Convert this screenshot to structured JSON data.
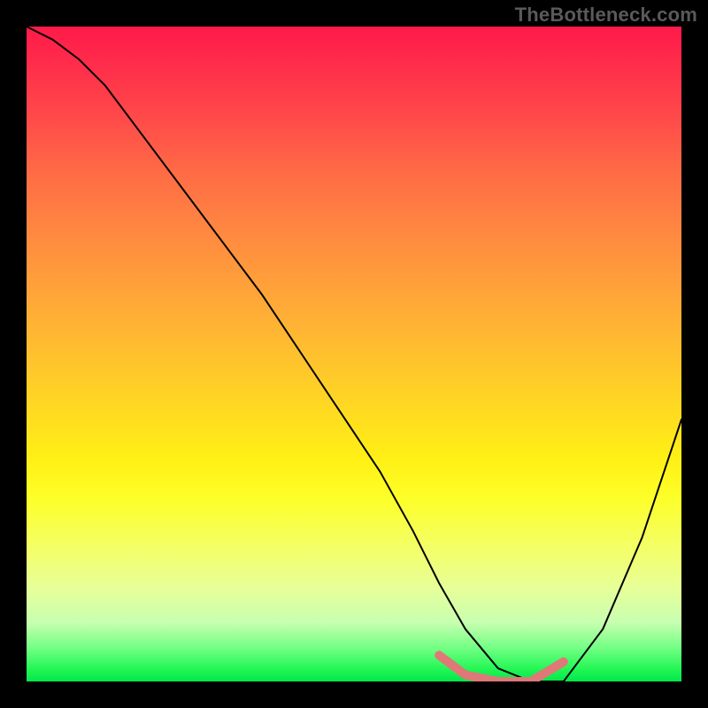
{
  "watermark": "TheBottleneck.com",
  "chart_data": {
    "type": "line",
    "title": "",
    "xlabel": "",
    "ylabel": "",
    "xlim": [
      0,
      100
    ],
    "ylim": [
      0,
      100
    ],
    "series": [
      {
        "name": "bottleneck-curve",
        "color": "#000000",
        "x": [
          0,
          4,
          8,
          12,
          18,
          24,
          30,
          36,
          42,
          48,
          54,
          59,
          63,
          67,
          72,
          77,
          82,
          88,
          94,
          100
        ],
        "values": [
          100,
          98,
          95,
          91,
          83,
          75,
          67,
          59,
          50,
          41,
          32,
          23,
          15,
          8,
          2,
          0,
          0,
          8,
          22,
          40
        ]
      },
      {
        "name": "valley-marker",
        "color": "#e26a6a",
        "x": [
          63,
          67,
          72,
          77,
          82
        ],
        "values": [
          4,
          1,
          0,
          0,
          3
        ]
      }
    ],
    "gradient_stops": [
      {
        "pct": 0,
        "color": "#ff1a4a"
      },
      {
        "pct": 14,
        "color": "#ff4a4a"
      },
      {
        "pct": 32,
        "color": "#ff8a40"
      },
      {
        "pct": 56,
        "color": "#ffd225"
      },
      {
        "pct": 72,
        "color": "#fdff28"
      },
      {
        "pct": 91,
        "color": "#c7ffb0"
      },
      {
        "pct": 100,
        "color": "#00e84a"
      }
    ]
  }
}
